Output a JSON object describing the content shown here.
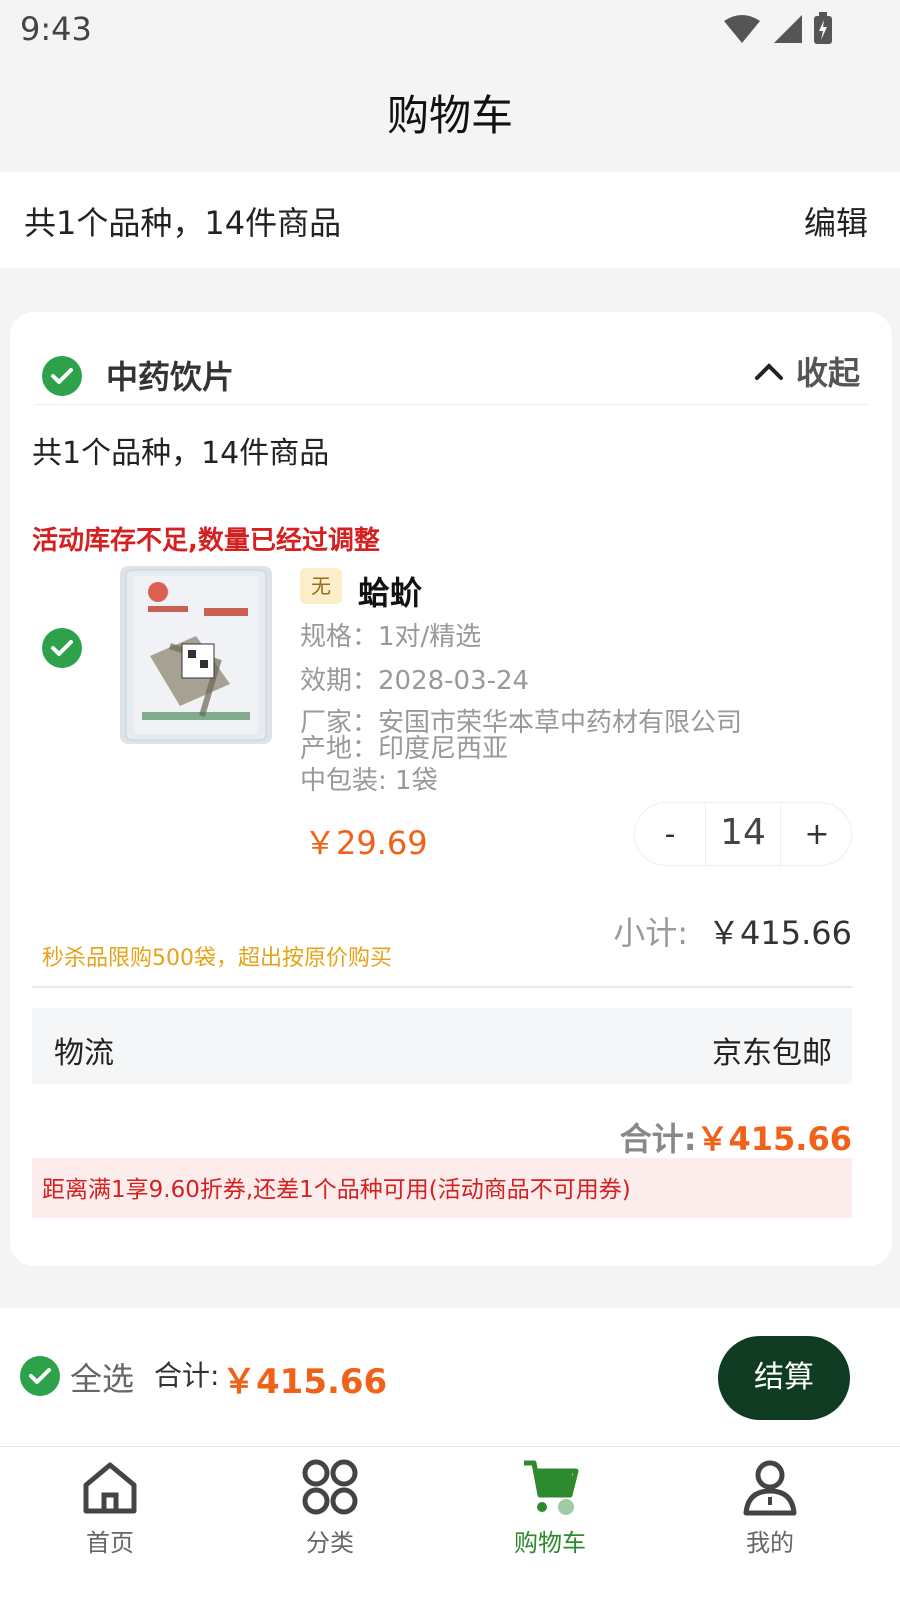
{
  "status_bar": {
    "time": "9:43"
  },
  "header": {
    "title": "购物车"
  },
  "summary_bar": {
    "text": "共1个品种，14件商品",
    "edit_label": "编辑"
  },
  "cart_group": {
    "name": "中药饮片",
    "collapse_label": "收起",
    "summary": "共1个品种，14件商品",
    "stock_warning": "活动库存不足,数量已经过调整",
    "item": {
      "tag": "无",
      "name": "蛤蚧",
      "spec": "规格：1对/精选",
      "expiry": "效期：2028-03-24",
      "manufacturer": "厂家：安国市荣华本草中药材有限公司",
      "origin": "产地：印度尼西亚",
      "package": "中包装: 1袋",
      "price": "￥29.69",
      "quantity": "14",
      "minus_label": "-",
      "plus_label": "+",
      "subtotal_label": "小计:",
      "subtotal": "￥415.66",
      "flash_note": "秒杀品限购500袋，超出按原价购买"
    },
    "logistics_label": "物流",
    "logistics_value": "京东包邮",
    "total_label": "合计:",
    "total": "￥415.66",
    "coupon_note": "距离满1享9.60折券,还差1个品种可用(活动商品不可用券)"
  },
  "checkout_bar": {
    "select_all_label": "全选",
    "total_label": "合计:",
    "total": "￥415.66",
    "checkout_label": "结算"
  },
  "tab_bar": {
    "tabs": [
      {
        "label": "首页",
        "icon": "home-icon"
      },
      {
        "label": "分类",
        "icon": "category-icon"
      },
      {
        "label": "购物车",
        "icon": "cart-icon",
        "active": true
      },
      {
        "label": "我的",
        "icon": "user-icon"
      }
    ]
  },
  "colors": {
    "accent": "#2ea24a",
    "price": "#f0611a",
    "warning": "#d62020",
    "checkout_button": "#0e3b22",
    "active_tab": "#2d8a2e"
  }
}
